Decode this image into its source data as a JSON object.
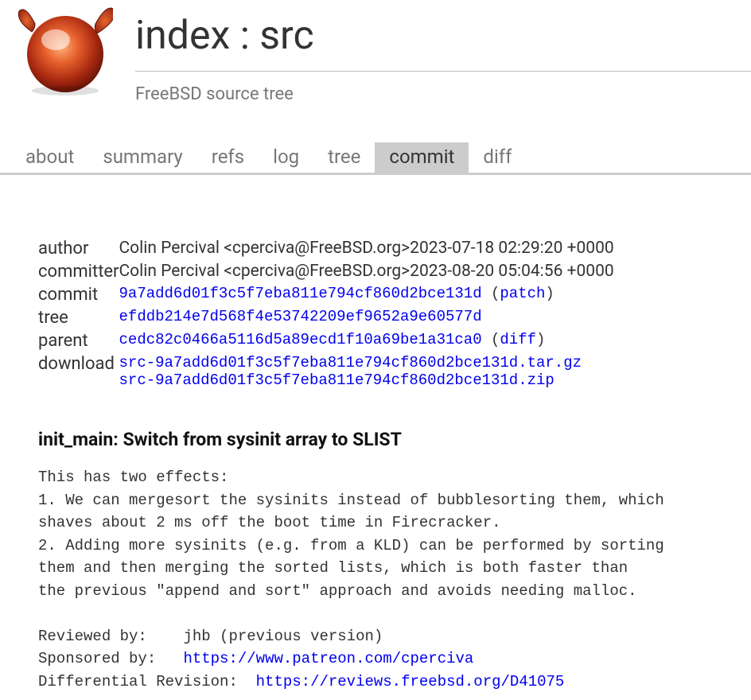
{
  "header": {
    "index_label": "index",
    "separator": " : ",
    "repo_name": "src",
    "subtitle": "FreeBSD source tree"
  },
  "tabs": {
    "items": [
      {
        "label": "about",
        "active": false
      },
      {
        "label": "summary",
        "active": false
      },
      {
        "label": "refs",
        "active": false
      },
      {
        "label": "log",
        "active": false
      },
      {
        "label": "tree",
        "active": false
      },
      {
        "label": "commit",
        "active": true
      },
      {
        "label": "diff",
        "active": false
      }
    ]
  },
  "meta": {
    "author_label": "author",
    "author_name": "Colin Percival <cperciva@FreeBSD.org>",
    "author_date": "2023-07-18 02:29:20 +0000",
    "committer_label": "committer",
    "committer_name": "Colin Percival <cperciva@FreeBSD.org>",
    "committer_date": "2023-08-20 05:04:56 +0000",
    "commit_label": "commit",
    "commit_hash": "9a7add6d01f3c5f7eba811e794cf860d2bce131d",
    "patch_label": "patch",
    "tree_label": "tree",
    "tree_hash": "efddb214e7d568f4e53742209ef9652a9e60577d",
    "parent_label": "parent",
    "parent_hash": "cedc82c0466a5116d5a89ecd1f10a69be1a31ca0",
    "diff_label": "diff",
    "download_label": "download",
    "download_tar": "src-9a7add6d01f3c5f7eba811e794cf860d2bce131d.tar.gz",
    "download_zip": "src-9a7add6d01f3c5f7eba811e794cf860d2bce131d.zip"
  },
  "commit": {
    "subject": "init_main: Switch from sysinit array to SLIST",
    "body1": "This has two effects:\n1. We can mergesort the sysinits instead of bubblesorting them, which\nshaves about 2 ms off the boot time in Firecracker.\n2. Adding more sysinits (e.g. from a KLD) can be performed by sorting\nthem and then merging the sorted lists, which is both faster than\nthe previous \"append and sort\" approach and avoids needing malloc.",
    "reviewed_by_label": "Reviewed by:",
    "reviewed_by_value": "jhb (previous version)",
    "sponsored_by_label": "Sponsored by:",
    "sponsored_by_link": "https://www.patreon.com/cperciva",
    "diffrev_label": "Differential Revision:",
    "diffrev_link": "https://reviews.freebsd.org/D41075"
  }
}
